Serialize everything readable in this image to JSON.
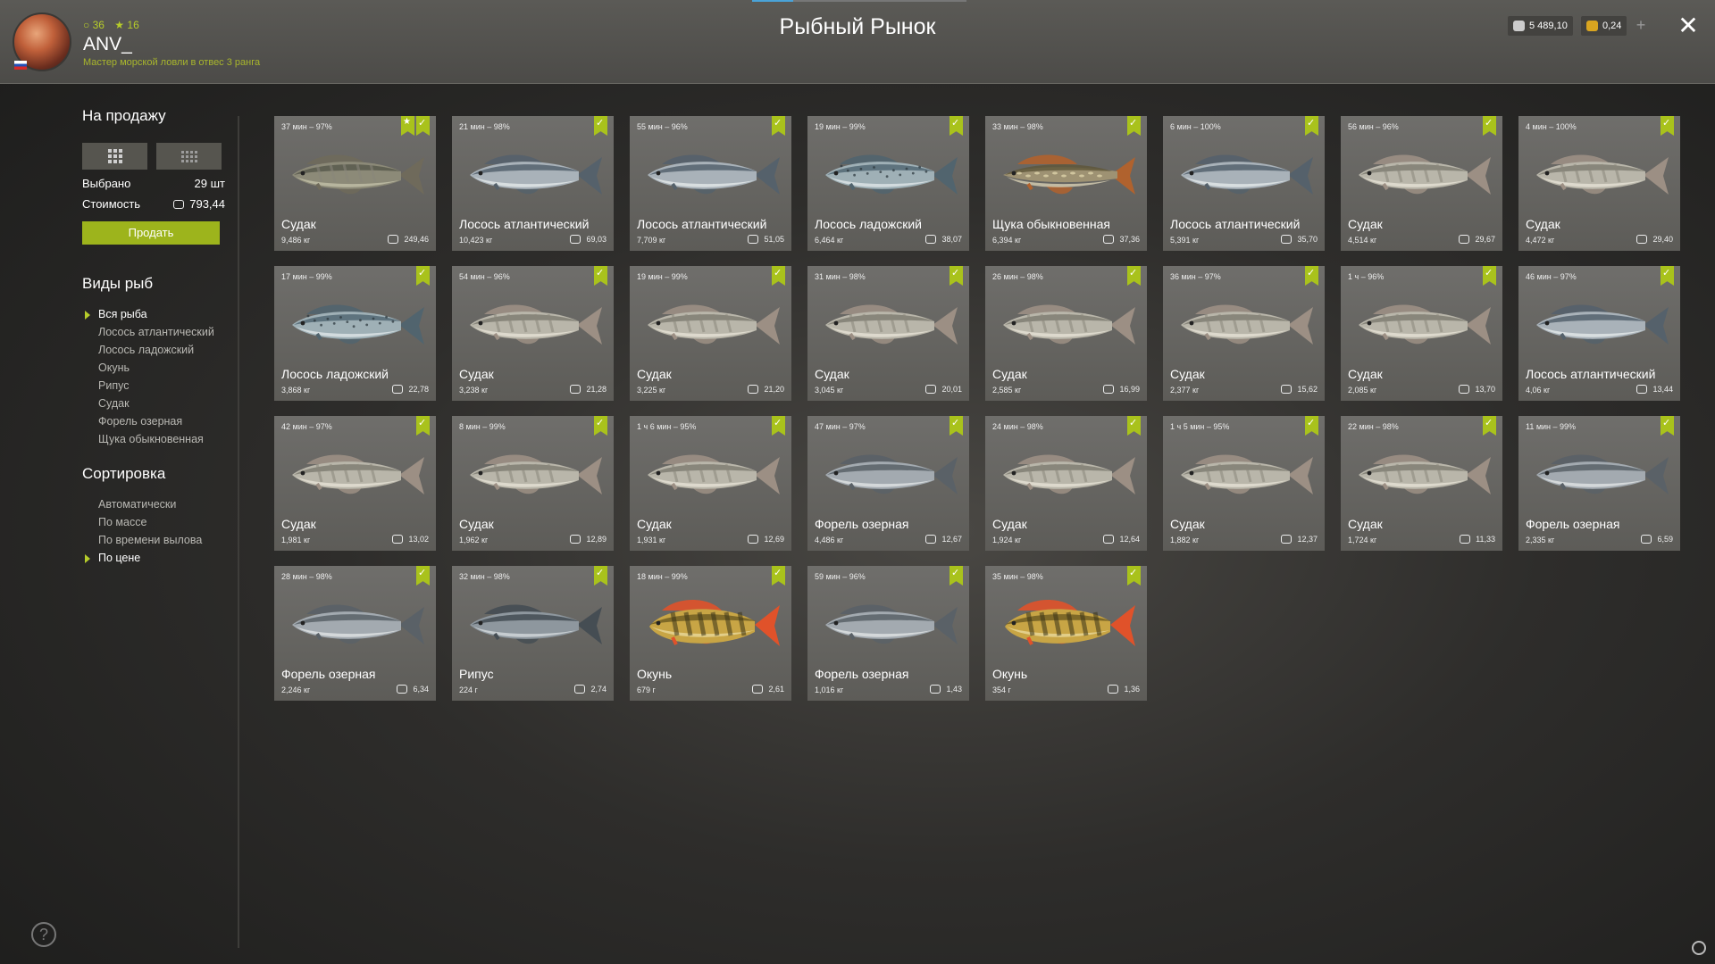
{
  "header": {
    "title": "Рыбный Рынок",
    "level": "36",
    "stars": "16",
    "username": "ANV_",
    "rank": "Мастер морской ловли в отвес 3 ранга",
    "silver": "5 489,10",
    "gold": "0,24",
    "plus": "+",
    "close": "✕"
  },
  "sidebar": {
    "sale_title": "На продажу",
    "selected_label": "Выбрано",
    "selected_value": "29 шт",
    "cost_label": "Стоимость",
    "cost_value": "793,44",
    "sell_button": "Продать",
    "species_title": "Виды рыб",
    "species": [
      "Вся рыба",
      "Лосось атлантический",
      "Лосось ладожский",
      "Окунь",
      "Рипус",
      "Судак",
      "Форель озерная",
      "Щука обыкновенная"
    ],
    "species_active": 0,
    "sort_title": "Сортировка",
    "sort": [
      "Автоматически",
      "По массе",
      "По времени вылова",
      "По цене"
    ],
    "sort_active": 3
  },
  "fish": [
    {
      "time": "37 мин – 97%",
      "name": "Судак",
      "weight": "9,486 кг",
      "price": "249,46",
      "type": "zander-big",
      "star": true
    },
    {
      "time": "21 мин – 98%",
      "name": "Лосось атлантический",
      "weight": "10,423 кг",
      "price": "69,03",
      "type": "salmon"
    },
    {
      "time": "55 мин – 96%",
      "name": "Лосось атлантический",
      "weight": "7,709 кг",
      "price": "51,05",
      "type": "salmon"
    },
    {
      "time": "19 мин – 99%",
      "name": "Лосось ладожский",
      "weight": "6,464 кг",
      "price": "38,07",
      "type": "ladoga"
    },
    {
      "time": "33 мин – 98%",
      "name": "Щука обыкновенная",
      "weight": "6,394 кг",
      "price": "37,36",
      "type": "pike"
    },
    {
      "time": "6 мин – 100%",
      "name": "Лосось атлантический",
      "weight": "5,391 кг",
      "price": "35,70",
      "type": "salmon"
    },
    {
      "time": "56 мин – 96%",
      "name": "Судак",
      "weight": "4,514 кг",
      "price": "29,67",
      "type": "zander"
    },
    {
      "time": "4 мин – 100%",
      "name": "Судак",
      "weight": "4,472 кг",
      "price": "29,40",
      "type": "zander"
    },
    {
      "time": "17 мин – 99%",
      "name": "Лосось ладожский",
      "weight": "3,868 кг",
      "price": "22,78",
      "type": "ladoga"
    },
    {
      "time": "54 мин – 96%",
      "name": "Судак",
      "weight": "3,238 кг",
      "price": "21,28",
      "type": "zander"
    },
    {
      "time": "19 мин – 99%",
      "name": "Судак",
      "weight": "3,225 кг",
      "price": "21,20",
      "type": "zander"
    },
    {
      "time": "31 мин – 98%",
      "name": "Судак",
      "weight": "3,045 кг",
      "price": "20,01",
      "type": "zander"
    },
    {
      "time": "26 мин – 98%",
      "name": "Судак",
      "weight": "2,585 кг",
      "price": "16,99",
      "type": "zander"
    },
    {
      "time": "36 мин – 97%",
      "name": "Судак",
      "weight": "2,377 кг",
      "price": "15,62",
      "type": "zander"
    },
    {
      "time": "1 ч – 96%",
      "name": "Судак",
      "weight": "2,085 кг",
      "price": "13,70",
      "type": "zander"
    },
    {
      "time": "46 мин – 97%",
      "name": "Лосось атлантический",
      "weight": "4,06 кг",
      "price": "13,44",
      "type": "salmon"
    },
    {
      "time": "42 мин – 97%",
      "name": "Судак",
      "weight": "1,981 кг",
      "price": "13,02",
      "type": "zander"
    },
    {
      "time": "8 мин – 99%",
      "name": "Судак",
      "weight": "1,962 кг",
      "price": "12,89",
      "type": "zander"
    },
    {
      "time": "1 ч 6 мин – 95%",
      "name": "Судак",
      "weight": "1,931 кг",
      "price": "12,69",
      "type": "zander"
    },
    {
      "time": "47 мин – 97%",
      "name": "Форель озерная",
      "weight": "4,486 кг",
      "price": "12,67",
      "type": "trout"
    },
    {
      "time": "24 мин – 98%",
      "name": "Судак",
      "weight": "1,924 кг",
      "price": "12,64",
      "type": "zander"
    },
    {
      "time": "1 ч 5 мин – 95%",
      "name": "Судак",
      "weight": "1,882 кг",
      "price": "12,37",
      "type": "zander"
    },
    {
      "time": "22 мин – 98%",
      "name": "Судак",
      "weight": "1,724 кг",
      "price": "11,33",
      "type": "zander"
    },
    {
      "time": "11 мин – 99%",
      "name": "Форель озерная",
      "weight": "2,335 кг",
      "price": "6,59",
      "type": "trout"
    },
    {
      "time": "28 мин – 98%",
      "name": "Форель озерная",
      "weight": "2,246 кг",
      "price": "6,34",
      "type": "trout"
    },
    {
      "time": "32 мин – 98%",
      "name": "Рипус",
      "weight": "224 г",
      "price": "2,74",
      "type": "ripus"
    },
    {
      "time": "18 мин – 99%",
      "name": "Окунь",
      "weight": "679 г",
      "price": "2,61",
      "type": "perch"
    },
    {
      "time": "59 мин – 96%",
      "name": "Форель озерная",
      "weight": "1,016 кг",
      "price": "1,43",
      "type": "trout"
    },
    {
      "time": "35 мин – 98%",
      "name": "Окунь",
      "weight": "354 г",
      "price": "1,36",
      "type": "perch"
    }
  ],
  "colors": {
    "accent": "#a9c21c",
    "card": "#666561"
  },
  "help": "?"
}
